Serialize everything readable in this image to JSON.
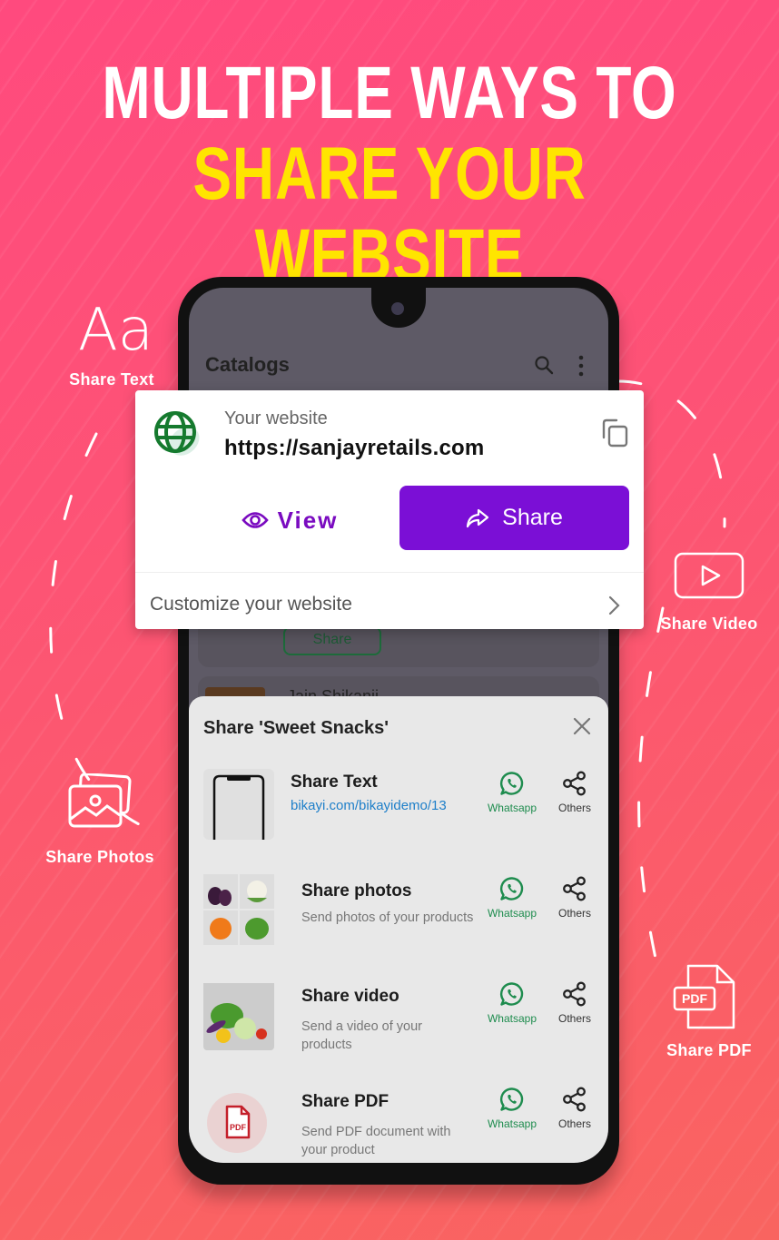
{
  "headline": {
    "line1": "MULTIPLE WAYS TO",
    "line2": "SHARE YOUR WEBSITE"
  },
  "colors": {
    "accent_purple": "#7b0fd6",
    "whatsapp_green": "#1e8c4e",
    "globe_green": "#157a2e",
    "headline_yellow": "#ffe500",
    "link_blue": "#1e7fc9"
  },
  "features": {
    "text": {
      "glyph": "Aa",
      "label": "Share Text",
      "icon": "text-icon"
    },
    "photos": {
      "label": "Share Photos",
      "icon": "photos-icon"
    },
    "video": {
      "label": "Share Video",
      "icon": "play-icon"
    },
    "pdf": {
      "label": "Share PDF",
      "icon": "pdf-icon",
      "badge": "PDF"
    }
  },
  "app": {
    "title": "Catalogs",
    "background_button": "Share",
    "background_item": "Jain Shikanji"
  },
  "website_card": {
    "label": "Your website",
    "url": "https://sanjayretails.com",
    "view_label": "View",
    "share_label": "Share",
    "customize_label": "Customize your website"
  },
  "share_sheet": {
    "title": "Share 'Sweet Snacks'",
    "rows": [
      {
        "title": "Share Text",
        "link": "bikayi.com/bikayidemo/13",
        "whatsapp": "Whatsapp",
        "others": "Others"
      },
      {
        "title": "Share photos",
        "subtitle": "Send photos of your products",
        "whatsapp": "Whatsapp",
        "others": "Others"
      },
      {
        "title": "Share video",
        "subtitle": "Send a video of your products",
        "whatsapp": "Whatsapp",
        "others": "Others"
      },
      {
        "title": "Share PDF",
        "subtitle": "Send PDF document with your product",
        "whatsapp": "Whatsapp",
        "others": "Others",
        "badge": "PDF"
      }
    ]
  }
}
